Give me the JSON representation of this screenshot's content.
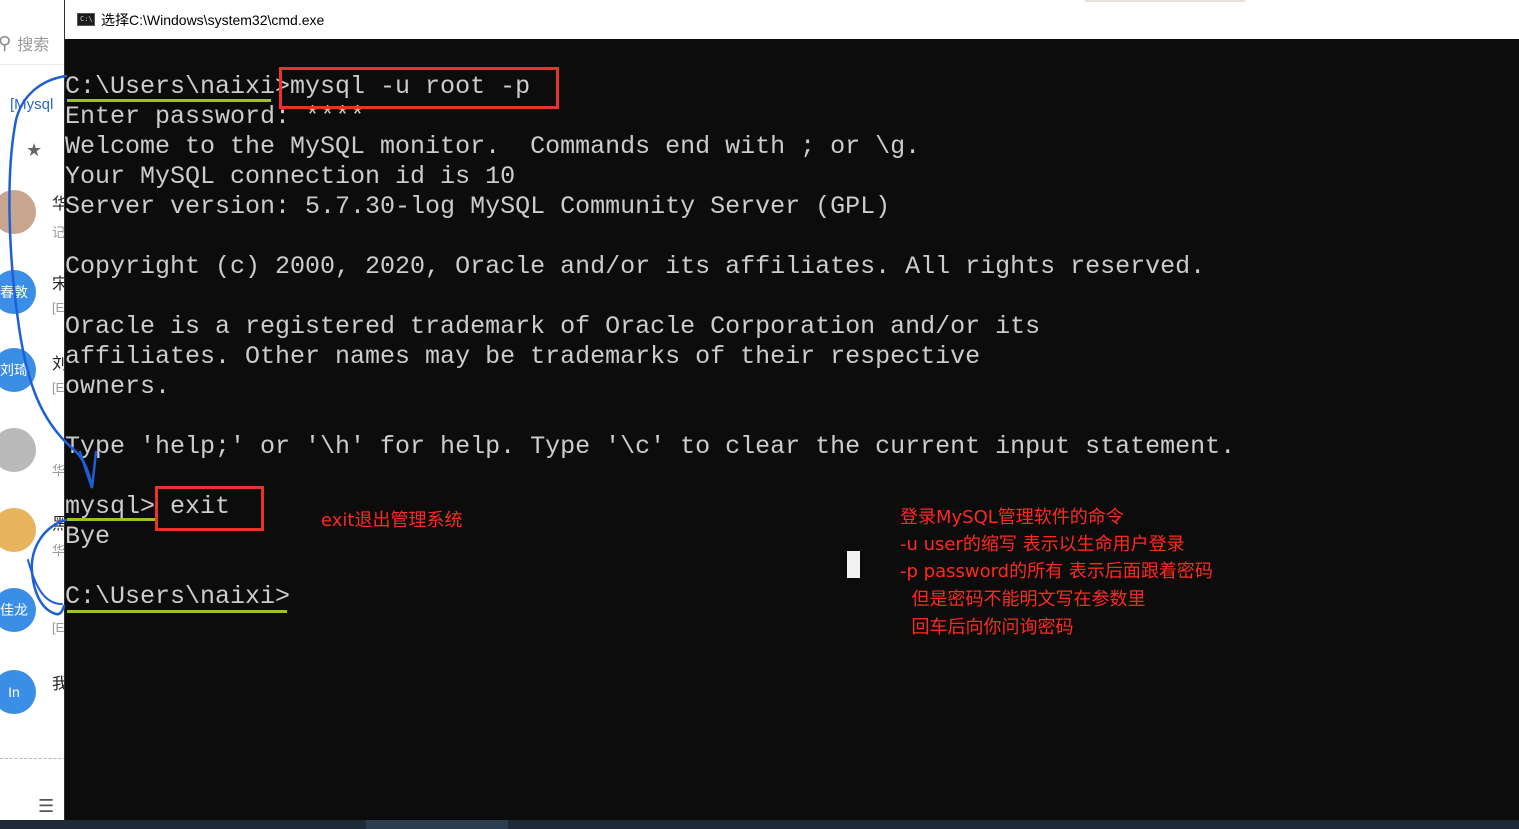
{
  "background_app": {
    "search_placeholder": "搜索",
    "link_text": "[Mysql",
    "contacts": [
      {
        "avatar_text": "",
        "name": "华",
        "sub": "记"
      },
      {
        "avatar_text": "春敦",
        "name": "宋",
        "sub": "[E"
      },
      {
        "avatar_text": "刘琦",
        "name": "刘",
        "sub": "[E"
      },
      {
        "avatar_text": "",
        "name": "",
        "sub": "华"
      },
      {
        "avatar_text": "",
        "name": "黑",
        "sub": "华"
      },
      {
        "avatar_text": "佳龙",
        "name": "",
        "sub": "[E"
      },
      {
        "avatar_text": "In",
        "name": "我",
        "sub": ""
      }
    ]
  },
  "window": {
    "title": "选择C:\\Windows\\system32\\cmd.exe",
    "icon_text": "C:\\"
  },
  "console": {
    "lines": [
      "C:\\Users\\naixi>mysql -u root -p",
      "Enter password: ****",
      "Welcome to the MySQL monitor.  Commands end with ; or \\g.",
      "Your MySQL connection id is 10",
      "Server version: 5.7.30-log MySQL Community Server (GPL)",
      "",
      "Copyright (c) 2000, 2020, Oracle and/or its affiliates. All rights reserved.",
      "",
      "Oracle is a registered trademark of Oracle Corporation and/or its",
      "affiliates. Other names may be trademarks of their respective",
      "owners.",
      "",
      "Type 'help;' or '\\h' for help. Type '\\c' to clear the current input statement.",
      "",
      "mysql> exit",
      "Bye",
      "",
      "C:\\Users\\naixi>"
    ]
  },
  "annotations": {
    "exit_note": "exit退出管理系统",
    "login_note": [
      "登录MySQL管理软件的命令",
      "-u user的缩写 表示以生命用户登录",
      "-p password的所有 表示后面跟着密码",
      "  但是密码不能明文写在参数里",
      "  回车后向你问询密码"
    ]
  },
  "colors": {
    "console_bg": "#0c0c0c",
    "console_text": "#cccccc",
    "annotation_red": "#e8322a",
    "annotation_green": "#9ec21f",
    "annotation_blue": "#1f5fd6"
  }
}
